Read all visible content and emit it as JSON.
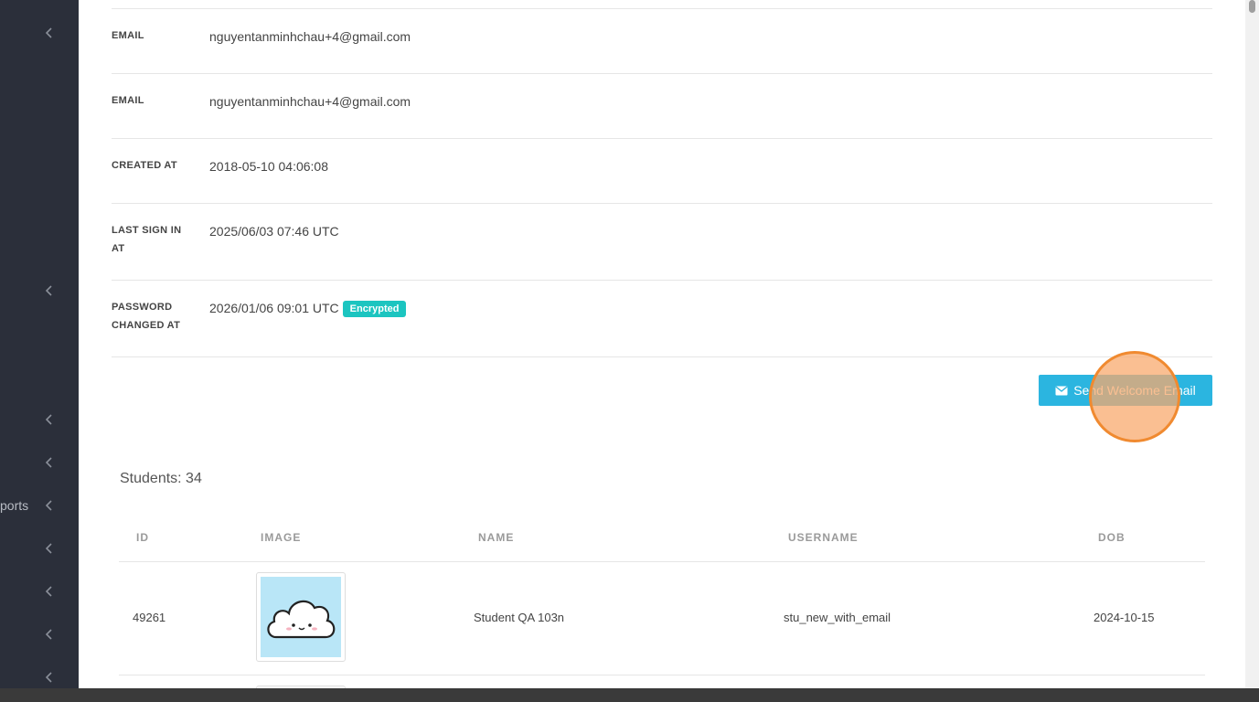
{
  "sidebar": {
    "partial_label": "ports"
  },
  "details": [
    {
      "label": "EMAIL",
      "value": "nguyentanminhchau+4@gmail.com"
    },
    {
      "label": "EMAIL",
      "value": "nguyentanminhchau+4@gmail.com"
    },
    {
      "label": "CREATED AT",
      "value": "2018-05-10 04:06:08"
    },
    {
      "label": "LAST SIGN IN AT",
      "value": "2025/06/03 07:46 UTC"
    },
    {
      "label": "PASSWORD CHANGED AT",
      "value": "2026/01/06 09:01 UTC",
      "badge": "Encrypted"
    }
  ],
  "actions": {
    "send_welcome_label": "Send Welcome Email"
  },
  "students": {
    "count_label": "Students: 34",
    "columns": [
      "ID",
      "IMAGE",
      "NAME",
      "USERNAME",
      "DOB"
    ],
    "rows": [
      {
        "id": "49261",
        "name": "Student QA 103n",
        "username": "stu_new_with_email",
        "dob": "2024-10-15"
      }
    ]
  },
  "colors": {
    "badge": "#1cc5c0",
    "button": "#2bb5e0",
    "sidebar": "#2b2f3a"
  }
}
